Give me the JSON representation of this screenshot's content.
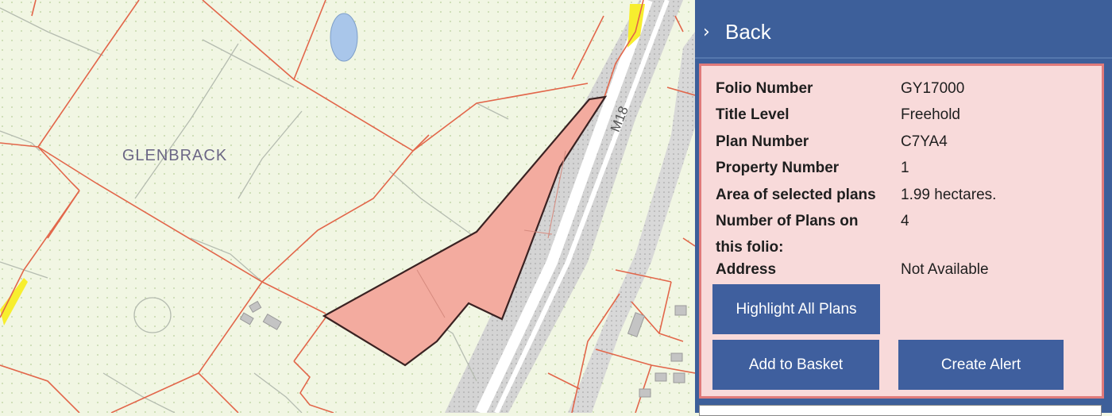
{
  "map": {
    "place_label": "GLENBRACK",
    "road_label": "M18",
    "colors": {
      "background": "#f1f6e3",
      "boundary": "#e2664a",
      "selected_fill": "#f3ab9f",
      "selected_outline": "#3a2222",
      "motorway": "#d4d4d4",
      "water": "#a9c6ea",
      "highlight_yellow": "#f7ee2e"
    }
  },
  "panel": {
    "back_label": "Back",
    "back_icon": "chevron-right-icon",
    "details": [
      {
        "key": "Folio Number",
        "value": "GY17000"
      },
      {
        "key": "Title Level",
        "value": "Freehold"
      },
      {
        "key": "Plan Number",
        "value": "C7YA4"
      },
      {
        "key": "Property Number",
        "value": "1"
      },
      {
        "key": "Area of selected plans",
        "value": "1.99 hectares."
      },
      {
        "key": "Number of Plans on this folio:",
        "value": "4"
      },
      {
        "key": "Address",
        "value": "Not Available"
      }
    ],
    "buttons": {
      "highlight": "Highlight All Plans",
      "basket": "Add to Basket",
      "alert": "Create Alert"
    },
    "colors": {
      "header": "#3d5f9a",
      "info_bg": "#f8dada",
      "info_border": "#e07a7a",
      "button": "#3f5f9e"
    }
  }
}
